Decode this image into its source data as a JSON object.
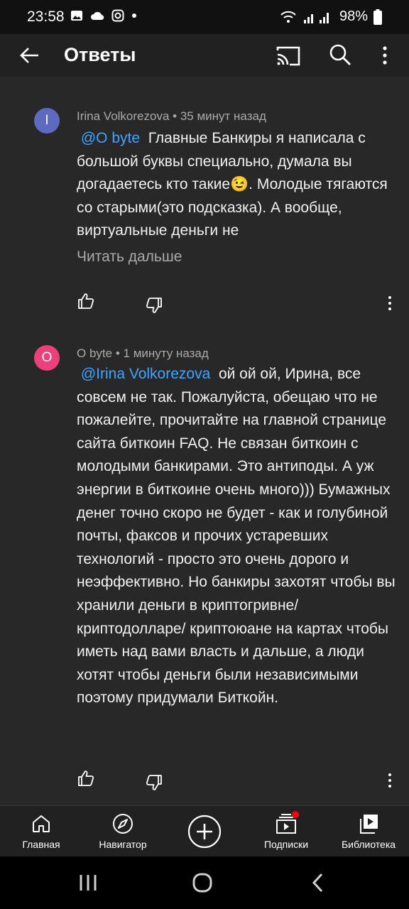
{
  "status_bar": {
    "time": "23:58",
    "battery": "98%",
    "icons": [
      "gallery-icon",
      "cloud-icon",
      "instagram-icon",
      "dot-icon",
      "wifi-icon",
      "signal-icon",
      "battery-icon"
    ]
  },
  "app_bar": {
    "title": "Ответы",
    "icons": [
      "back-arrow-icon",
      "cast-icon",
      "search-icon",
      "more-vert-icon"
    ]
  },
  "comments": [
    {
      "avatar_letter": "I",
      "avatar_color": "#5c6bc0",
      "author": "Irina Volkorezova",
      "time": "35 минут назад",
      "mention": "@O byte",
      "text": "Главные Банкиры я написала с большой буквы специально, думала вы догадаетесь кто такие😉. Молодые тягаются со старыми(это подсказка). А вообще, виртуальные деньги не",
      "read_more": "Читать дальше"
    },
    {
      "avatar_letter": "O",
      "avatar_color": "#ec407a",
      "author": "O byte",
      "time": "1 минуту назад",
      "mention": "@Irina Volkorezova",
      "text": "ой ой ой, Ирина, все совсем не так. Пожалуйста, обещаю что не пожалейте, прочитайте на главной странице сайта биткоин FAQ. Не связан биткоин с молодыми банкирами. Это антиподы. А уж энергии в биткоине очень много))) Бумажных денег точно скоро не будет - как и голубиной почты, факсов и прочих устаревших технологий - просто это очень дорого и неэффективно. Но банкиры захотят чтобы вы хранили деньги в криптогривне/криптодолларе/ криптоюане на картах чтобы иметь над вами власть и дальше, а люди хотят чтобы деньги были независимыми поэтому придумали Биткойн."
    }
  ],
  "bottom_nav": {
    "items": [
      {
        "label": "Главная",
        "icon": "home-icon"
      },
      {
        "label": "Навигатор",
        "icon": "compass-icon"
      },
      {
        "label": "",
        "icon": "create-icon"
      },
      {
        "label": "Подписки",
        "icon": "subscriptions-icon",
        "badge_color": "#ff0000"
      },
      {
        "label": "Библиотека",
        "icon": "library-icon"
      }
    ]
  },
  "system_nav": {
    "icons": [
      "recents-icon",
      "home-circle-icon",
      "back-chevron-icon"
    ]
  }
}
